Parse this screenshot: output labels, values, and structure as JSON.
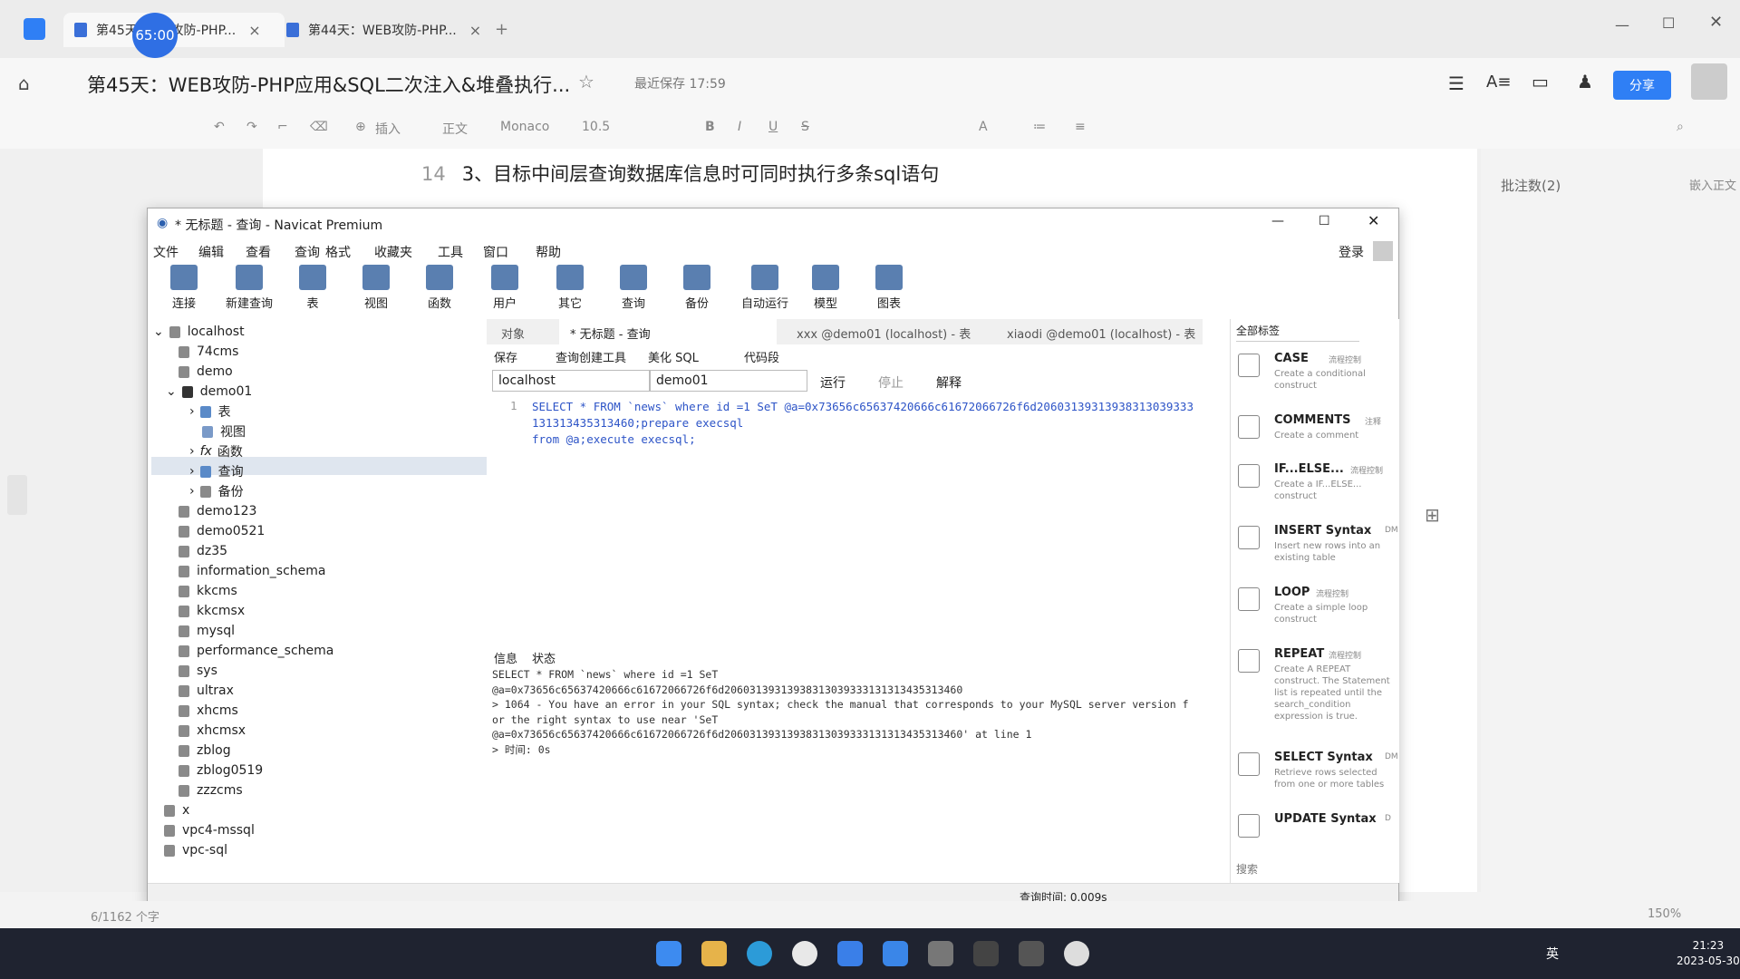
{
  "browser": {
    "timer": "65:00",
    "tabs": [
      {
        "label": "第45天 WEB攻防-PHP..."
      },
      {
        "label": "第44天：WEB攻防-PHP..."
      }
    ]
  },
  "doc": {
    "title": "第45天：WEB攻防-PHP应用&SQL二次注入&堆叠执行...",
    "saved": "最近保存 17:59",
    "share": "分享",
    "line_number": "14",
    "line_text": "3、目标中间层查询数据库信息时可同时执行多条sql语句",
    "comments": "批注数(2)",
    "embed": "嵌入正文",
    "toolbar": {
      "insert": "插入",
      "style": "正文",
      "font": "Monaco",
      "size": "10.5"
    },
    "status": {
      "words": "6/1162 个字",
      "zoom": "150%"
    }
  },
  "navicat": {
    "title": "* 无标题 - 查询 - Navicat Premium",
    "login": "登录",
    "menu": [
      "文件",
      "编辑",
      "查看",
      "查询",
      "格式",
      "收藏夹",
      "工具",
      "窗口",
      "帮助"
    ],
    "tools": [
      "连接",
      "新建查询",
      "表",
      "视图",
      "函数",
      "用户",
      "其它",
      "查询",
      "备份",
      "自动运行",
      "模型",
      "图表"
    ],
    "tree": {
      "root": "localhost",
      "dbs": [
        "74cms",
        "demo",
        "demo01"
      ],
      "demo01_children": [
        "表",
        "视图",
        "函数",
        "查询",
        "备份"
      ],
      "more_dbs": [
        "demo123",
        "demo0521",
        "dz35",
        "information_schema",
        "kkcms",
        "kkcmsx",
        "mysql",
        "performance_schema",
        "sys",
        "ultrax",
        "xhcms",
        "xhcmsx",
        "zblog",
        "zblog0519",
        "zzzcms"
      ],
      "other_conns": [
        "x",
        "vpc4-mssql",
        "vpc-sql"
      ]
    },
    "tabs": {
      "objects": "对象",
      "query": "* 无标题 - 查询",
      "t1": "xxx @demo01 (localhost) - 表",
      "t2": "xiaodi @demo01 (localhost) - 表"
    },
    "querytools": {
      "save": "保存",
      "builder": "查询创建工具",
      "beautify": "美化 SQL",
      "snippet": "代码段",
      "run": "运行",
      "stop": "停止",
      "explain": "解释"
    },
    "conn_select": "localhost",
    "db_select": "demo01",
    "editor": {
      "line": "1",
      "sql_a": "SELECT * FROM `news` where id =1 SeT @a=0x73656c65637420666c61672066726f6d20603139313938313039333131313435313460;prepare execsql",
      "sql_b": "from @a;execute execsql;"
    },
    "msg_tabs": [
      "信息",
      "状态"
    ],
    "message": "SELECT * FROM `news` where id =1 SeT\n@a=0x73656c65637420666c61672066726f6d20603139313938313039333131313435313460\n> 1064 - You have an error in your SQL syntax; check the manual that corresponds to your MySQL server version for the right syntax to use near 'SeT\n@a=0x73656c65637420666c61672066726f6d20603139313938313039333131313435313460' at line 1\n> 时间: 0s",
    "snippets_filter": "全部标签",
    "snippets": [
      {
        "title": "CASE",
        "tag": "流程控制",
        "desc": "Create a conditional construct"
      },
      {
        "title": "COMMENTS",
        "tag": "注释",
        "desc": "Create a comment"
      },
      {
        "title": "IF...ELSE...",
        "tag": "流程控制",
        "desc": "Create a IF...ELSE... construct"
      },
      {
        "title": "INSERT Syntax",
        "tag": "DM",
        "desc": "Insert new rows into an existing table"
      },
      {
        "title": "LOOP",
        "tag": "流程控制",
        "desc": "Create a simple loop construct"
      },
      {
        "title": "REPEAT",
        "tag": "流程控制",
        "desc": "Create A REPEAT construct. The Statement list is repeated until the search_condition expression is true."
      },
      {
        "title": "SELECT Syntax",
        "tag": "DM",
        "desc": "Retrieve rows selected from one or more tables"
      },
      {
        "title": "UPDATE Syntax",
        "tag": "D",
        "desc": ""
      }
    ],
    "search": "搜索",
    "query_time": "查询时间: 0.009s"
  },
  "taskbar": {
    "time": "21:23",
    "date": "2023-05-30",
    "lang": "英"
  }
}
